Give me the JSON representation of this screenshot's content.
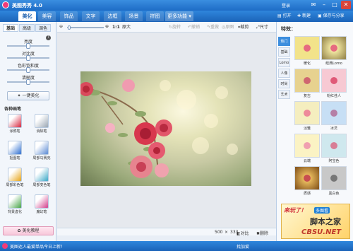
{
  "app": {
    "title": "美图秀秀 4.0",
    "login": "登录"
  },
  "tabs": [
    {
      "label": "美化",
      "active": true
    },
    {
      "label": "美容",
      "active": false
    },
    {
      "label": "饰品",
      "active": false
    },
    {
      "label": "文字",
      "active": false
    },
    {
      "label": "边框",
      "active": false
    },
    {
      "label": "场景",
      "active": false
    },
    {
      "label": "拼图",
      "active": false
    },
    {
      "label": "更多功能 ▾",
      "active": false
    }
  ],
  "tabbar_right": {
    "open": "打开",
    "new": "新建",
    "save": "保存与分享"
  },
  "left_panel": {
    "tabs": [
      "基础",
      "高级",
      "调色"
    ],
    "sliders": [
      {
        "label": "亮度",
        "value": 0.5
      },
      {
        "label": "对比度",
        "value": 0.5
      },
      {
        "label": "色彩饱和度",
        "value": 0.5
      },
      {
        "label": "清晰度",
        "value": 0.5
      }
    ],
    "one_click": "一键美化",
    "brush_title": "各种画笔",
    "brushes": [
      {
        "label": "涂鸦笔",
        "icon": "doodle-pen-icon",
        "color": "#d7263d"
      },
      {
        "label": "消除笔",
        "icon": "eraser-icon",
        "color": "#9aa6b2"
      },
      {
        "label": "抠图笔",
        "icon": "cutout-pen-icon",
        "color": "#2f6fd0"
      },
      {
        "label": "局部马赛克",
        "icon": "mosaic-icon",
        "color": "#5b8bd4"
      },
      {
        "label": "局部彩色笔",
        "icon": "color-brush-icon",
        "color": "#e7a417"
      },
      {
        "label": "局部变色笔",
        "icon": "recolor-brush-icon",
        "color": "#3aa7c7"
      },
      {
        "label": "背景虚化",
        "icon": "blur-bg-icon",
        "color": "#47a447"
      },
      {
        "label": "魔幻笔",
        "icon": "magic-pen-icon",
        "color": "#d23f8c"
      }
    ],
    "tutorial": "美化教程"
  },
  "toolbar": {
    "zoom_ratio": "1:1",
    "zoom_fit": "原大",
    "rotate": "旋转",
    "undo": "撤销",
    "redo": "重做",
    "original": "原图",
    "crop": "裁剪",
    "resize": "尺寸"
  },
  "canvas": {
    "image": "pink-roses-photo"
  },
  "status": {
    "width": "500",
    "x": "×",
    "height": "333",
    "compare": "对比",
    "delete": "删除"
  },
  "bottom": {
    "message": "美图达人最爱单品今日上新！",
    "social": "找加爱"
  },
  "right_panel": {
    "title": "特效：",
    "tabs": [
      {
        "label": "热门",
        "active": true
      },
      {
        "label": "基础",
        "active": false
      },
      {
        "label": "Lomo",
        "active": false
      },
      {
        "label": "人像",
        "active": false
      },
      {
        "label": "时尚",
        "active": false
      },
      {
        "label": "艺术",
        "active": false
      }
    ],
    "effects": [
      {
        "label": "暖化",
        "tint": "#f2e38a"
      },
      {
        "label": "经典Lomo",
        "tint": "#f0e6a0"
      },
      {
        "label": "复古",
        "tint": "#e7d28f"
      },
      {
        "label": "粉红佳人",
        "tint": "#f7c9d3"
      },
      {
        "label": "淡雅",
        "tint": "#f5eebf"
      },
      {
        "label": "冰灵",
        "tint": "#c7dff5"
      },
      {
        "label": "云端",
        "tint": "#fbf3c4"
      },
      {
        "label": "阿宝色",
        "tint": "#cfe8ee"
      },
      {
        "label": "质感",
        "tint": "#e6b85c"
      },
      {
        "label": "黑白色",
        "tint": "#c8c8c8"
      }
    ],
    "ad": {
      "text1": "来玩了！",
      "text2": "多图看",
      "brand": "脚本之家",
      "domain": "CBSU.NET"
    }
  },
  "colors": {
    "accent": "#1b63b8",
    "pink": "#f03c7a"
  }
}
